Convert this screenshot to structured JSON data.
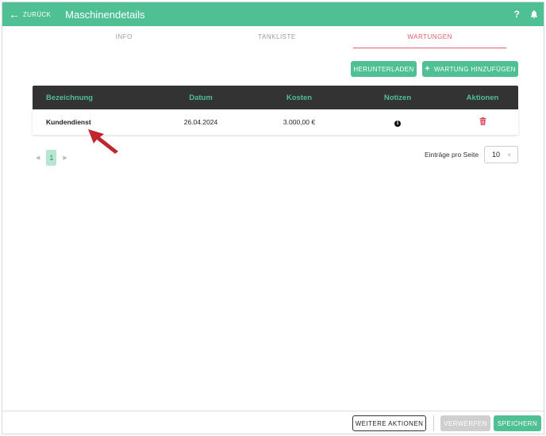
{
  "header": {
    "back_label": "ZURÜCK",
    "title": "Maschinendetails",
    "help": "?"
  },
  "tabs": [
    {
      "label": "INFO",
      "active": false
    },
    {
      "label": "TANKLISTE",
      "active": false
    },
    {
      "label": "WARTUNGEN",
      "active": true
    }
  ],
  "actions": {
    "download_label": "HERUNTERLADEN",
    "add_label": "WARTUNG HINZUFÜGEN"
  },
  "table": {
    "columns": [
      "Bezeichnung",
      "Datum",
      "Kosten",
      "Notizen",
      "Aktionen"
    ],
    "rows": [
      {
        "name": "Kundendienst",
        "date": "26.04.2024",
        "cost": "3.000,00 €"
      }
    ]
  },
  "pagination": {
    "current_page": "1",
    "per_page_label": "Einträge pro Seite",
    "per_page_value": "10",
    "clear": "×"
  },
  "footer": {
    "more_actions_label": "WEITERE AKTIONEN",
    "discard_label": "VERWERFEN",
    "save_label": "SPEICHERN"
  },
  "colors": {
    "accent": "#4fbf94",
    "active_tab": "#e25d6b",
    "table_header_bg": "#333333",
    "delete_icon": "#e0445a",
    "annotation_arrow": "#c0272d"
  },
  "icons": {
    "back": "arrow-left-icon",
    "help": "help-icon",
    "notifications": "bell-icon",
    "notes": "info-icon",
    "delete": "trash-icon"
  }
}
